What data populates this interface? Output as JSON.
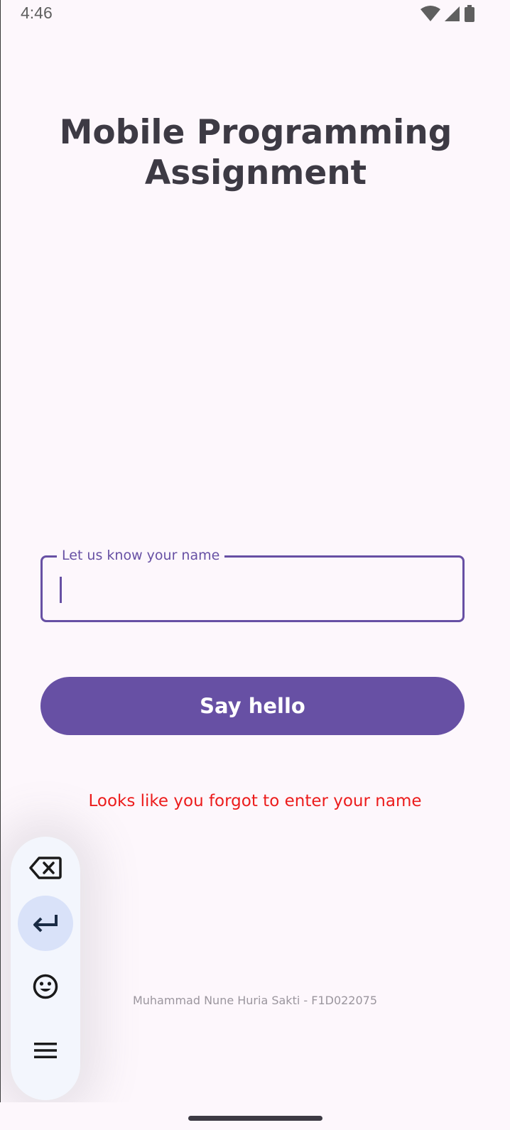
{
  "status_bar": {
    "time": "4:46",
    "icons": [
      "wifi-icon",
      "cellular-signal-icon",
      "battery-icon"
    ]
  },
  "app": {
    "title": "Mobile Programming Assignment",
    "name_field": {
      "label": "Let us know your name",
      "value": ""
    },
    "say_hello_button": "Say hello",
    "error_message": "Looks like you forgot to enter your name",
    "footer": "Muhammad Nune Huria Sakti - F1D022075"
  },
  "keyboard_toolbar": {
    "items": [
      "backspace-icon",
      "enter-icon",
      "emoji-icon",
      "menu-icon"
    ],
    "active": "enter-icon"
  },
  "colors": {
    "background": "#fdf7fc",
    "primary": "#6750a4",
    "error": "#ec1c1c",
    "title": "#3d3a44",
    "footer": "#9b969e"
  }
}
